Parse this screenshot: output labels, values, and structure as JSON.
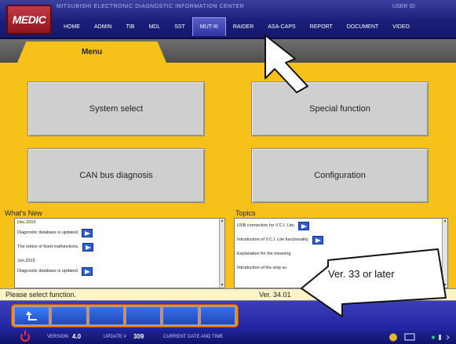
{
  "header": {
    "logo_text": "MEDIC",
    "center_name": "MITSUBISHI ELECTRONIC DIAGNOSTIC INFORMATION CENTER",
    "user_id_label": "USER ID:",
    "nav_items": [
      {
        "label": "HOME"
      },
      {
        "label": "ADMIN"
      },
      {
        "label": "TIB"
      },
      {
        "label": "MDL"
      },
      {
        "label": "SST"
      },
      {
        "label": "MUT-III",
        "active": true
      },
      {
        "label": "RAIDER"
      },
      {
        "label": "ASA-CAPS"
      },
      {
        "label": "REPORT"
      },
      {
        "label": "DOCUMENT"
      },
      {
        "label": "VIDEO"
      }
    ]
  },
  "main": {
    "tab_label": "Menu",
    "buttons": {
      "system_select": "System select",
      "special_function": "Special function",
      "can_bus_diagnosis": "CAN bus diagnosis",
      "configuration": "Configuration"
    }
  },
  "whats_new": {
    "title": "What's New",
    "items": [
      {
        "text": "Dec.2015",
        "type": "date"
      },
      {
        "text": "Diagnostic database is updated.",
        "type": "link"
      },
      {
        "text": "The notice of fixed malfunctions.",
        "type": "link"
      },
      {
        "text": "Jun.2015",
        "type": "date"
      },
      {
        "text": "Diagnostic database is updated.",
        "type": "link"
      }
    ]
  },
  "topics": {
    "title": "Topics",
    "items": [
      {
        "text": "USB connection for V.C.I. Lite."
      },
      {
        "text": "Introduction of V.C.I. Lite functionality."
      },
      {
        "text": "Explanation for the meaning"
      },
      {
        "text": "Introduction of the stop su"
      }
    ]
  },
  "status": {
    "message": "Please select function.",
    "version": "Ver. 34.01"
  },
  "footer": {
    "version_label": "VERSION",
    "version_value": "4.0",
    "update_label": "UPDATE #",
    "update_value": "309",
    "current_datetime_label": "CURRENT DATE AND TIME"
  },
  "callout": {
    "text": "Ver. 33 or later"
  },
  "colors": {
    "panel_yellow": "#f6c21a",
    "nav_blue": "#1b1f7a",
    "button_grey": "#cfcfcf",
    "link_blue": "#2d5fd0"
  }
}
